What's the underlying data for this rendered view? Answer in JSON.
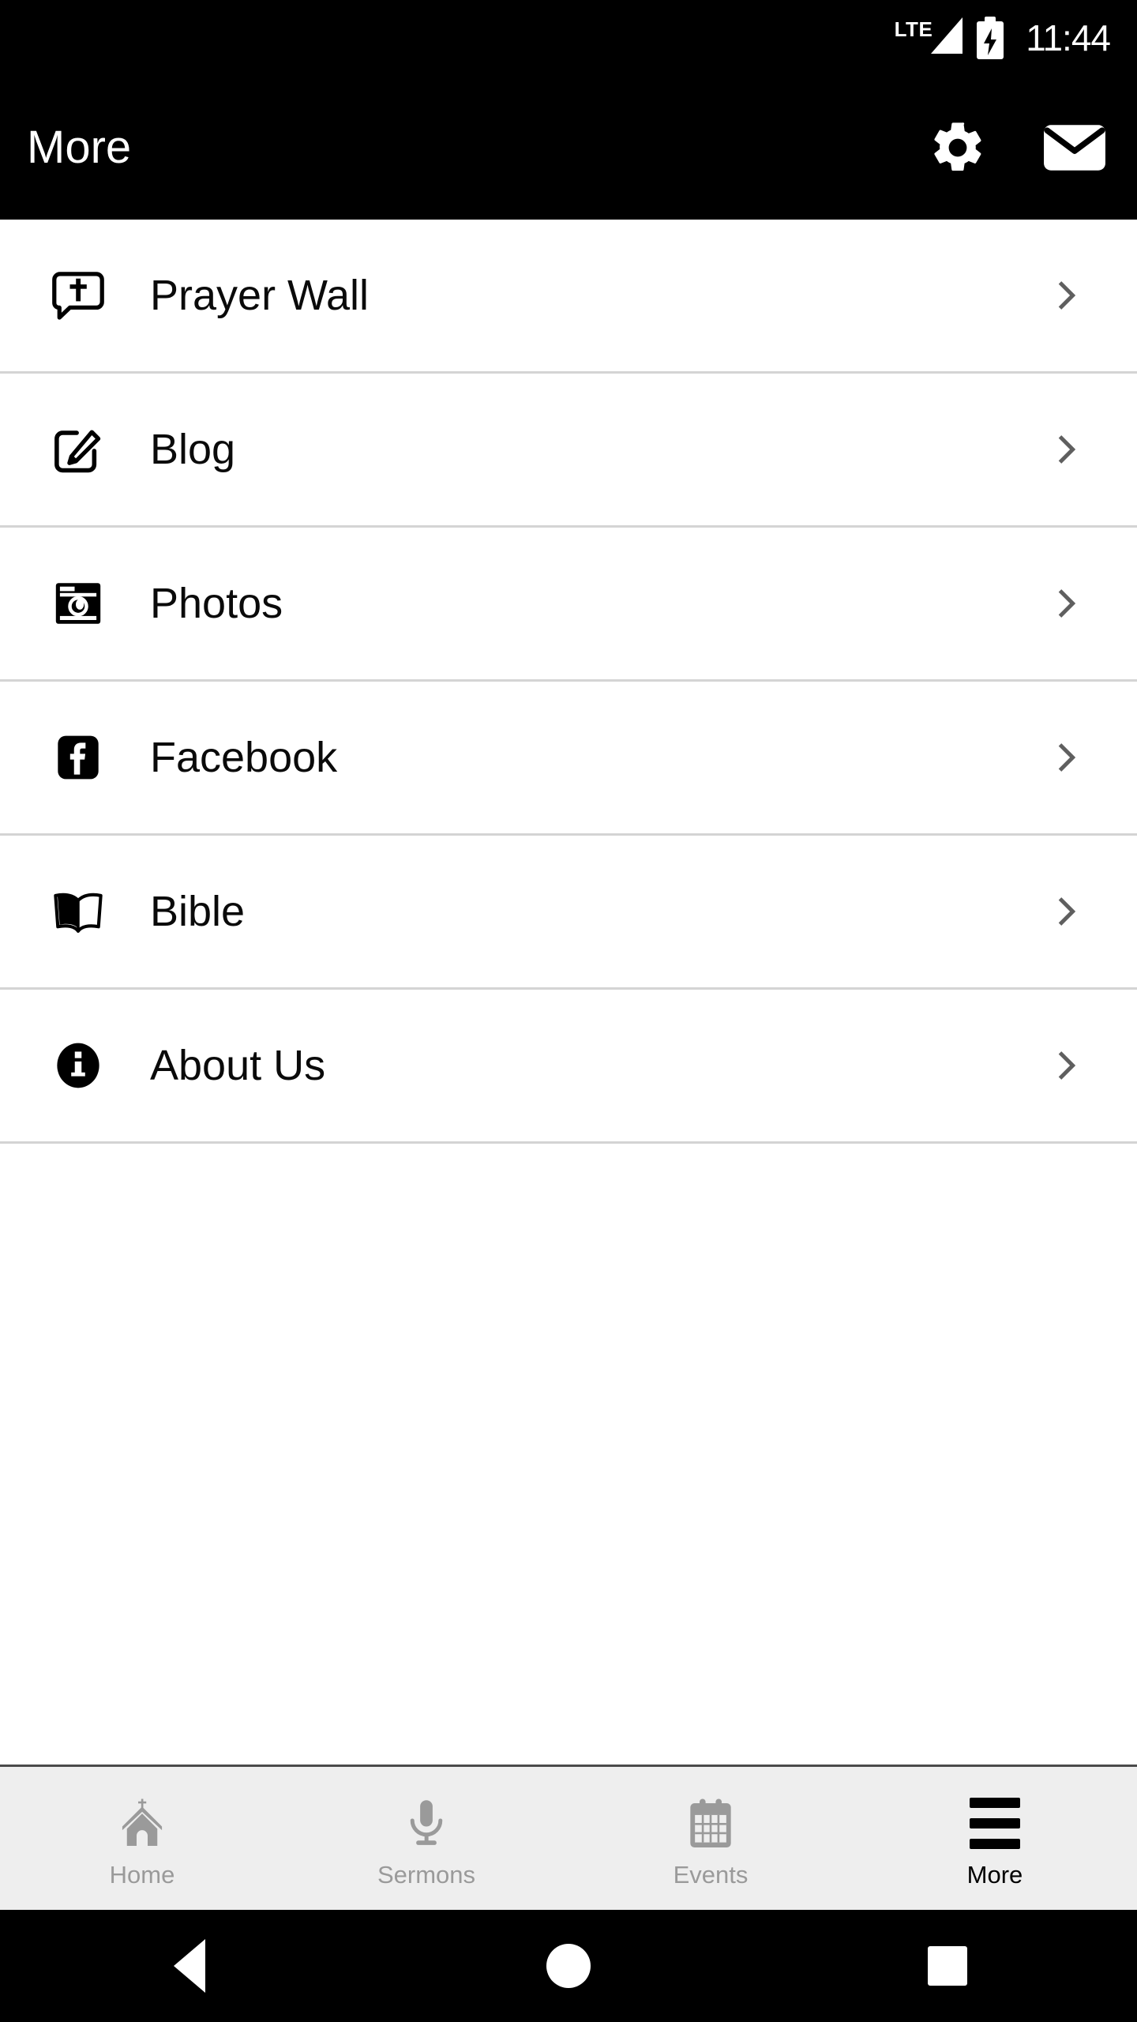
{
  "status_bar": {
    "network_label": "LTE",
    "signal_icon": "signal-bars-icon",
    "battery_icon": "battery-charging-icon",
    "time": "11:44"
  },
  "app_bar": {
    "title": "More",
    "actions": [
      {
        "name": "settings-button",
        "icon": "gear-icon"
      },
      {
        "name": "mail-button",
        "icon": "envelope-icon"
      }
    ]
  },
  "menu": {
    "items": [
      {
        "label": "Prayer Wall",
        "icon": "prayer-bubble-cross-icon",
        "chevron": "chevron-right-icon"
      },
      {
        "label": "Blog",
        "icon": "pencil-square-icon",
        "chevron": "chevron-right-icon"
      },
      {
        "label": "Photos",
        "icon": "camera-icon",
        "chevron": "chevron-right-icon"
      },
      {
        "label": "Facebook",
        "icon": "facebook-icon",
        "chevron": "chevron-right-icon"
      },
      {
        "label": "Bible",
        "icon": "open-book-icon",
        "chevron": "chevron-right-icon"
      },
      {
        "label": "About Us",
        "icon": "info-circle-icon",
        "chevron": "chevron-right-icon"
      }
    ]
  },
  "bottom_nav": {
    "items": [
      {
        "label": "Home",
        "icon": "church-icon",
        "active": false
      },
      {
        "label": "Sermons",
        "icon": "microphone-icon",
        "active": false
      },
      {
        "label": "Events",
        "icon": "calendar-icon",
        "active": false
      },
      {
        "label": "More",
        "icon": "hamburger-icon",
        "active": true
      }
    ]
  },
  "android_nav": {
    "back": "back-triangle-icon",
    "home": "home-circle-icon",
    "recents": "recents-square-icon"
  },
  "colors": {
    "app_bar_bg": "#000000",
    "page_bg": "#ffffff",
    "divider": "#d4d4d4",
    "nav_bg": "#eeeeee",
    "nav_inactive": "#9a9a9a",
    "nav_active": "#000000",
    "chevron": "#5f5f5f"
  }
}
